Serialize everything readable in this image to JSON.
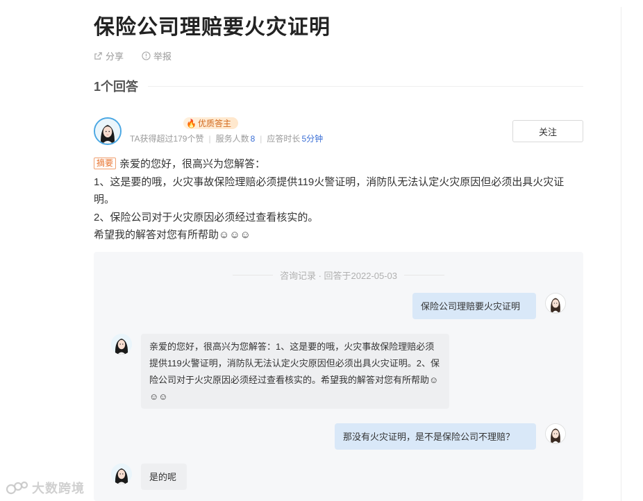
{
  "question": {
    "title": "保险公司理赔要火灾证明"
  },
  "actions": {
    "share": "分享",
    "report": "举报"
  },
  "answers_count": "1个回答",
  "author": {
    "badge": "优质答主",
    "stats_prefix": "TA获得超过179个赞",
    "served_label": "服务人数",
    "served_value": "8",
    "response_label": "应答时长",
    "response_value": "5分钟",
    "follow_label": "关注"
  },
  "answer": {
    "tag": "摘要",
    "lines": [
      "亲爱的您好，很高兴为您解答：",
      "1、这是要的哦，火灾事故保险理赔必须提供119火警证明，消防队无法认定火灾原因但必须出具火灾证明。",
      "2、保险公司对于火灾原因必须经过查看核实的。",
      "希望我的解答对您有所帮助☺☺☺"
    ]
  },
  "consult": {
    "header": "咨询记录 · 回答于2022-05-03",
    "messages": [
      {
        "from": "user",
        "text": "保险公司理赔要火灾证明"
      },
      {
        "from": "answerer",
        "text": "亲爱的您好，很高兴为您解答：1、这是要的哦，火灾事故保险理赔必须提供119火警证明，消防队无法认定火灾原因但必须出具火灾证明。2、保险公司对于火灾原因必须经过查看核实的。希望我的解答对您有所帮助☺☺☺"
      },
      {
        "from": "user",
        "text": "那没有火灾证明，是不是保险公司不理赔？"
      },
      {
        "from": "answerer",
        "text": "是的呢"
      }
    ]
  },
  "watermark": "大数跨境",
  "colors": {
    "link_blue": "#3b6fd6",
    "tag_orange": "#e8722c",
    "user_bubble": "#d9e8f8",
    "answer_bubble": "#eeeff1"
  }
}
